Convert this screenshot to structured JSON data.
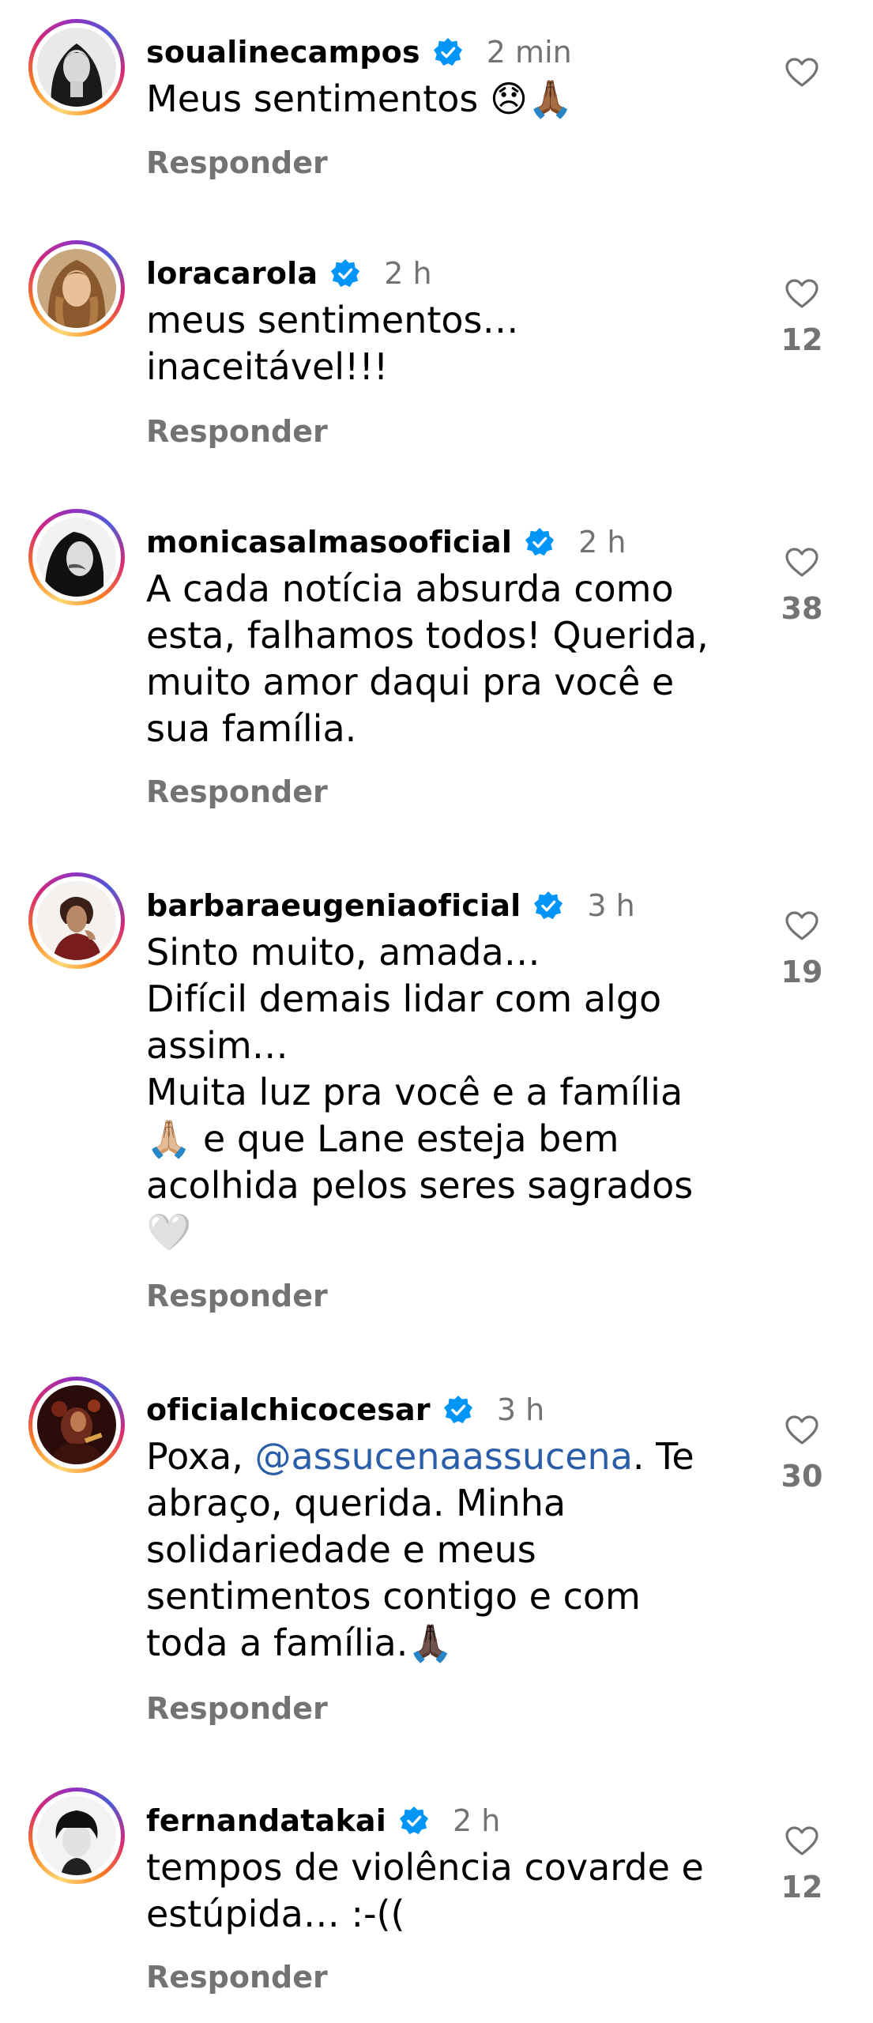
{
  "colors": {
    "text": "#000000",
    "secondary": "#737373",
    "verified": "#0095f6",
    "mention": "#2b5ea8",
    "ring": [
      "#feda75",
      "#fa7e1e",
      "#d62976",
      "#962fbf",
      "#4f5bd5"
    ]
  },
  "icons": {
    "verified": "verified-badge-icon",
    "like": "heart-outline-icon"
  },
  "comments": [
    {
      "username": "soualinecampos",
      "time": "2 min",
      "text": "Meus sentimentos 😞🙏🏾",
      "reply_label": "Responder",
      "likes": ""
    },
    {
      "username": "loracarola",
      "time": "2 h",
      "text": "meus sentimentos…\ninaceitável!!!",
      "reply_label": "Responder",
      "likes": "12"
    },
    {
      "username": "monicasalmasooficial",
      "time": "2 h",
      "text": "A cada notícia absurda como\nesta, falhamos todos! Querida,\nmuito amor daqui pra você e\nsua família.",
      "reply_label": "Responder",
      "likes": "38"
    },
    {
      "username": "barbaraeugeniaoficial",
      "time": "3 h",
      "text": "Sinto muito, amada…\nDifícil demais lidar com algo\nassim…\nMuita luz pra você e a família\n🙏🏼 e que Lane esteja bem\nacolhida pelos seres sagrados\n🤍",
      "reply_label": "Responder",
      "likes": "19"
    },
    {
      "username": "oficialchicocesar",
      "time": "3 h",
      "text_before": "Poxa, ",
      "mention": "@assucenaassucena",
      "text_after": ". Te\nabraço, querida. Minha\nsolidariedade e meus\nsentimentos contigo e com\ntoda a família.🙏🏿",
      "reply_label": "Responder",
      "likes": "30"
    },
    {
      "username": "fernandatakai",
      "time": "2 h",
      "text": "tempos de violência covarde e\nestúpida… :-((",
      "reply_label": "Responder",
      "likes": "12"
    }
  ]
}
